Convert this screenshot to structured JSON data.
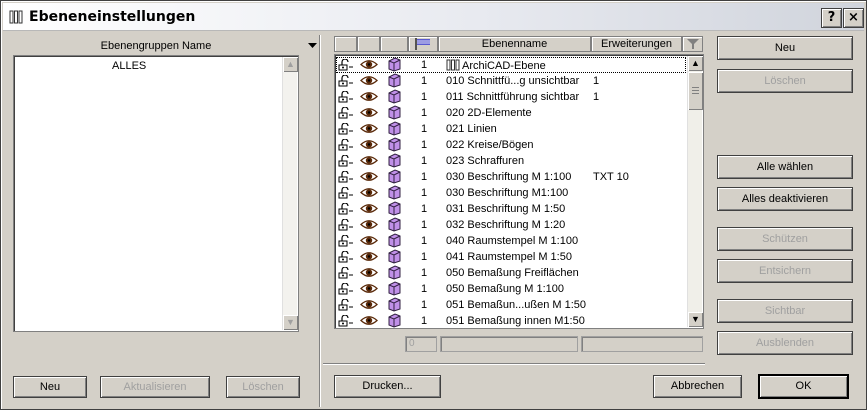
{
  "window": {
    "title": "Ebeneneinstellungen",
    "help_label": "?",
    "close_label": "×"
  },
  "groups": {
    "header": "Ebenengruppen Name",
    "items": [
      "ALLES"
    ],
    "new_label": "Neu",
    "update_label": "Aktualisieren",
    "delete_label": "Löschen"
  },
  "table": {
    "col_name": "Ebenenname",
    "col_ext": "Erweiterungen",
    "rows": [
      {
        "pen": "1",
        "name": "ArchiCAD-Ebene",
        "ext": "",
        "special": true
      },
      {
        "pen": "1",
        "name": "010 Schnittfü...g unsichtbar",
        "ext": "1"
      },
      {
        "pen": "1",
        "name": "011 Schnittführung sichtbar",
        "ext": "1"
      },
      {
        "pen": "1",
        "name": "020 2D-Elemente",
        "ext": ""
      },
      {
        "pen": "1",
        "name": "021 Linien",
        "ext": ""
      },
      {
        "pen": "1",
        "name": "022 Kreise/Bögen",
        "ext": ""
      },
      {
        "pen": "1",
        "name": "023 Schraffuren",
        "ext": ""
      },
      {
        "pen": "1",
        "name": "030 Beschriftung M 1:100",
        "ext": "TXT 10"
      },
      {
        "pen": "1",
        "name": "030 Beschriftung M1:100",
        "ext": ""
      },
      {
        "pen": "1",
        "name": "031 Beschriftung M 1:50",
        "ext": ""
      },
      {
        "pen": "1",
        "name": "032 Beschriftung M 1:20",
        "ext": ""
      },
      {
        "pen": "1",
        "name": "040 Raumstempel M 1:100",
        "ext": ""
      },
      {
        "pen": "1",
        "name": "041 Raumstempel M 1:50",
        "ext": ""
      },
      {
        "pen": "1",
        "name": "050 Bemaßung Freiflächen",
        "ext": ""
      },
      {
        "pen": "1",
        "name": "050 Bemaßung M 1:100",
        "ext": ""
      },
      {
        "pen": "1",
        "name": "051 Bemaßun...ußen M 1:50",
        "ext": ""
      },
      {
        "pen": "1",
        "name": "051 Bemaßung innen M1:50",
        "ext": ""
      }
    ],
    "edit_pen_value": "0"
  },
  "buttons": {
    "new": "Neu",
    "delete": "Löschen",
    "select_all": "Alle wählen",
    "deselect_all": "Alles deaktivieren",
    "protect": "Schützen",
    "unprotect": "Entsichern",
    "visible": "Sichtbar",
    "hide": "Ausblenden",
    "print": "Drucken...",
    "cancel": "Abbrechen",
    "ok": "OK"
  },
  "colors": {
    "eye": "#5a2a0a",
    "box": "#c090e8",
    "disabled_text": "#a0a0a0"
  }
}
